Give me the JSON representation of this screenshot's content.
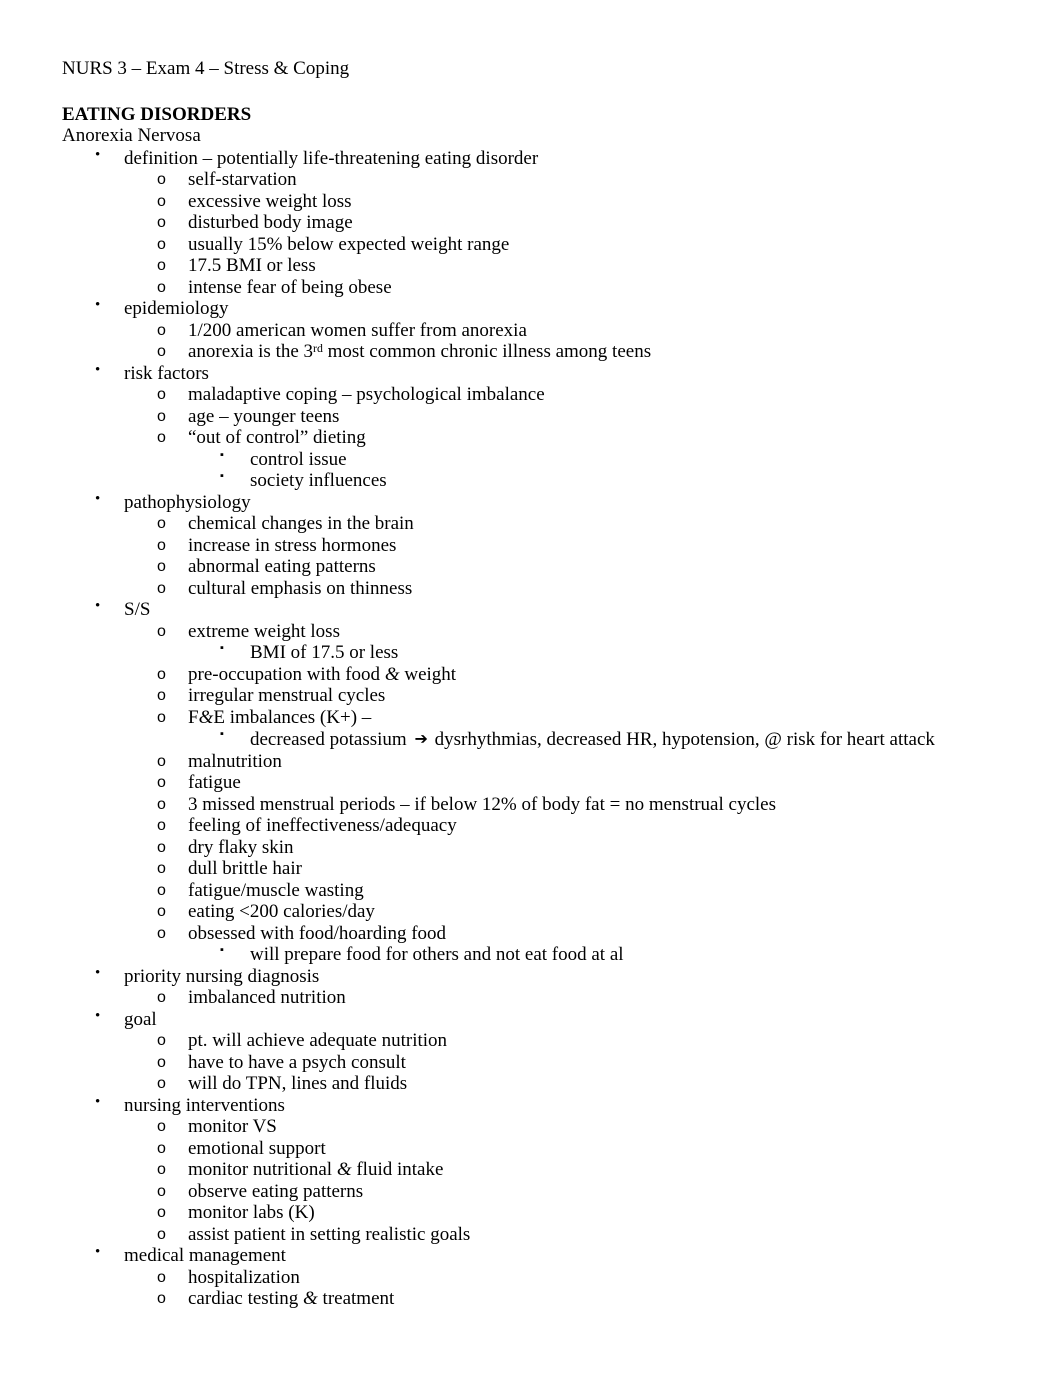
{
  "document": {
    "header": "NURS 3 – Exam 4 – Stress & Coping",
    "section_title": "EATING DISORDERS",
    "section_subtitle": "Anorexia Nervosa",
    "markers": {
      "level1": "•",
      "level2": "o",
      "level3": "▪"
    },
    "outline": [
      {
        "level": 1,
        "text": "definition – potentially life-threatening eating disorder"
      },
      {
        "level": 2,
        "text": "self-starvation"
      },
      {
        "level": 2,
        "text": "excessive weight loss"
      },
      {
        "level": 2,
        "text": "disturbed body image"
      },
      {
        "level": 2,
        "text": "usually 15% below expected weight range"
      },
      {
        "level": 2,
        "text": "17.5 BMI or less"
      },
      {
        "level": 2,
        "text": "intense fear of being obese"
      },
      {
        "level": 1,
        "text": "epidemiology"
      },
      {
        "level": 2,
        "text": "1/200 american women suffer from anorexia"
      },
      {
        "level": 2,
        "text": "anorexia is the 3rd most common chronic illness among teens",
        "superscript": {
          "before": "anorexia is the 3",
          "sup": "rd",
          "after": " most common chronic illness among teens"
        }
      },
      {
        "level": 1,
        "text": "risk factors"
      },
      {
        "level": 2,
        "text": "maladaptive coping – psychological imbalance"
      },
      {
        "level": 2,
        "text": "age – younger teens"
      },
      {
        "level": 2,
        "text": "“out of control” dieting"
      },
      {
        "level": 3,
        "text": "control issue"
      },
      {
        "level": 3,
        "text": "society influences"
      },
      {
        "level": 1,
        "text": "pathophysiology"
      },
      {
        "level": 2,
        "text": "chemical changes in the brain"
      },
      {
        "level": 2,
        "text": "increase in stress hormones"
      },
      {
        "level": 2,
        "text": "abnormal eating patterns"
      },
      {
        "level": 2,
        "text": "cultural emphasis on thinness"
      },
      {
        "level": 1,
        "text": "S/S"
      },
      {
        "level": 2,
        "text": "extreme weight loss"
      },
      {
        "level": 3,
        "text": "BMI of 17.5 or less"
      },
      {
        "level": 2,
        "text": "pre-occupation with food & weight"
      },
      {
        "level": 2,
        "text": "irregular menstrual cycles"
      },
      {
        "level": 2,
        "text": "F&E imbalances (K+) –"
      },
      {
        "level": 3,
        "text": "decreased potassium ➔ dysrhythmias, decreased HR, hypotension, @ risk for heart attack",
        "arrow": {
          "before": "decreased potassium ",
          "glyph": "➔",
          "after": " dysrhythmias, decreased HR, hypotension, @ risk for heart attack"
        }
      },
      {
        "level": 2,
        "text": "malnutrition"
      },
      {
        "level": 2,
        "text": "fatigue"
      },
      {
        "level": 2,
        "text": "3 missed menstrual periods – if below 12% of body fat = no menstrual cycles"
      },
      {
        "level": 2,
        "text": "feeling of ineffectiveness/adequacy"
      },
      {
        "level": 2,
        "text": "dry flaky skin"
      },
      {
        "level": 2,
        "text": "dull brittle hair"
      },
      {
        "level": 2,
        "text": "fatigue/muscle wasting"
      },
      {
        "level": 2,
        "text": "eating <200 calories/day"
      },
      {
        "level": 2,
        "text": "obsessed with food/hoarding food"
      },
      {
        "level": 3,
        "text": "will prepare food for others and not eat food at al"
      },
      {
        "level": 1,
        "text": "priority nursing diagnosis"
      },
      {
        "level": 2,
        "text": "imbalanced nutrition"
      },
      {
        "level": 1,
        "text": "goal"
      },
      {
        "level": 2,
        "text": "pt. will achieve adequate nutrition"
      },
      {
        "level": 2,
        "text": "have to have a psych consult"
      },
      {
        "level": 2,
        "text": "will do TPN, lines and fluids"
      },
      {
        "level": 1,
        "text": "nursing interventions"
      },
      {
        "level": 2,
        "text": "monitor VS"
      },
      {
        "level": 2,
        "text": "emotional support"
      },
      {
        "level": 2,
        "text": "monitor nutritional & fluid intake"
      },
      {
        "level": 2,
        "text": "observe eating patterns"
      },
      {
        "level": 2,
        "text": "monitor labs (K)"
      },
      {
        "level": 2,
        "text": "assist patient in setting realistic goals"
      },
      {
        "level": 1,
        "text": "medical management"
      },
      {
        "level": 2,
        "text": "hospitalization"
      },
      {
        "level": 2,
        "text": "cardiac testing & treatment"
      }
    ]
  }
}
